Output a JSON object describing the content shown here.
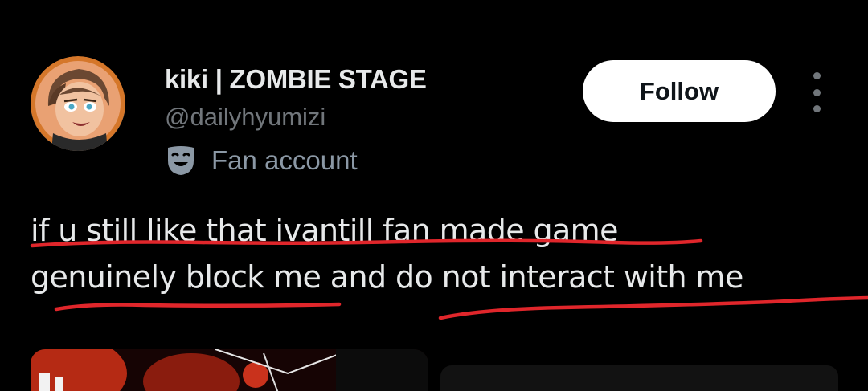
{
  "post": {
    "author": {
      "display_name": "kiki | ZOMBIE STAGE",
      "handle": "@dailyhyumizi",
      "avatar_icon": "anime-character-avatar",
      "affiliation_icon": "theater-mask-icon",
      "affiliation_label": "Fan account"
    },
    "follow_label": "Follow",
    "more_icon": "more-vertical-icon",
    "text_lines": [
      "if u still like that ivantill fan made game",
      "genuinely block me and do not interact with me"
    ],
    "annotation_color": "#e0262b",
    "media": [
      {
        "kind": "image",
        "tone": "dark-red"
      },
      {
        "kind": "image",
        "tone": "dark"
      }
    ]
  },
  "colors": {
    "background": "#000000",
    "text_primary": "#e7e9ea",
    "text_secondary": "#71767b",
    "follow_bg": "#ffffff",
    "follow_text": "#0f1419"
  }
}
